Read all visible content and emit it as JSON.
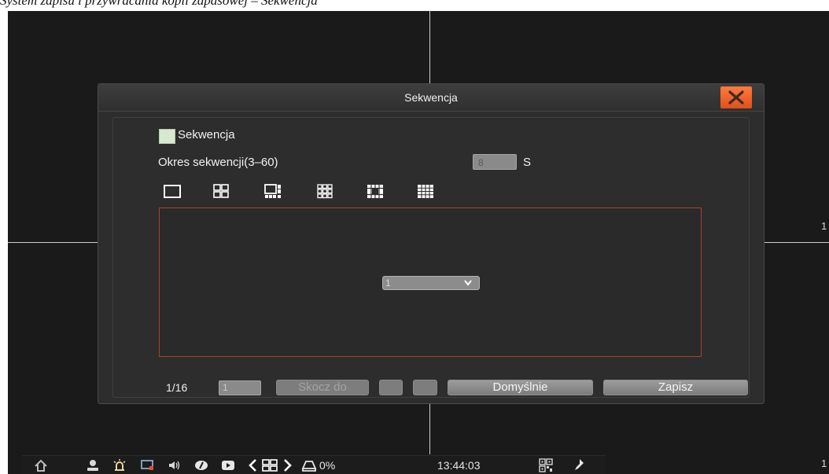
{
  "page_header": {
    "caption": "System zapisu i przywracania kopii zapasowej – Sekwencja"
  },
  "edge_labels": {
    "right_mid": "1",
    "right_bottom": "1"
  },
  "dialog": {
    "title": "Sekwencja",
    "enable_checkbox": {
      "label": "Sekwencja",
      "checked": false,
      "fill_color": "#d6e8cf"
    },
    "period": {
      "label": "Okres sekwencji(3–60)",
      "value": "8",
      "unit": "S"
    },
    "layouts": [
      "single-view-icon",
      "quad-view-icon",
      "six-view-icon",
      "nine-view-icon",
      "eight-view-icon",
      "sixteen-view-icon"
    ],
    "channel_select": {
      "value": "1"
    },
    "accent_color": "#a6452a",
    "close_color": "#f06028"
  },
  "bottom": {
    "page": "1/16",
    "jump_value": "1",
    "jump_label": "Skocz do",
    "default_label": "Domyślnie",
    "save_label": "Zapisz"
  },
  "taskbar": {
    "icons": [
      "home-icon",
      "user-icon",
      "alarm-icon",
      "monitor-icon",
      "volume-icon",
      "ptz-icon",
      "record-icon",
      "prev-icon",
      "layout-icon",
      "next-icon",
      "hdd-icon"
    ],
    "hdd_usage": "0%",
    "time": "13:44:03",
    "extra_icons": [
      "qr-code-icon",
      "pin-icon"
    ]
  }
}
